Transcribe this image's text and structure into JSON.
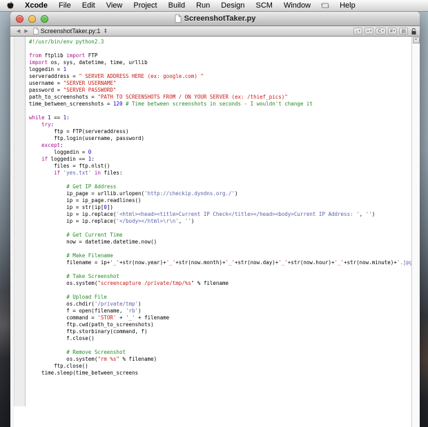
{
  "colors": {
    "traffic_red": "#ee6056",
    "traffic_yellow": "#f5bf4f",
    "traffic_green": "#61c554",
    "syntax_keyword": "#a90d91",
    "syntax_number": "#1c00cf",
    "syntax_string": "#c41a16",
    "syntax_charstring": "#5861a8",
    "syntax_comment": "#248a24"
  },
  "menu_bar": {
    "items": [
      "Xcode",
      "File",
      "Edit",
      "View",
      "Project",
      "Build",
      "Run",
      "Design",
      "SCM",
      "Window"
    ],
    "help_label": "Help",
    "apple_icon": "apple-logo",
    "script_icon": "script-menu-scroll"
  },
  "window": {
    "title": "ScreenshotTaker.py"
  },
  "nav_bar": {
    "back_label": "◀",
    "forward_label": "▶",
    "location": "ScreenshotTaker.py:1",
    "stepper_up": "▲",
    "stepper_down": "▼",
    "right_buttons": [
      {
        "name": "history-menu-button",
        "glyph": "↓",
        "has_arrow": true
      },
      {
        "name": "bookmarks-menu-button",
        "glyph": "≈",
        "has_arrow": true
      },
      {
        "name": "class-hierarchy-menu-button",
        "glyph": "C",
        "has_arrow": true
      },
      {
        "name": "marks-menu-button",
        "glyph": "#",
        "has_arrow": true
      },
      {
        "name": "counterpart-button",
        "glyph": "▤",
        "has_arrow": false
      }
    ],
    "split_button_glyph": "="
  },
  "editor": {
    "lines": [
      [
        [
          "c",
          "#!/usr/bin/env python2.3"
        ]
      ],
      [],
      [
        [
          "k",
          "from"
        ],
        [
          "p",
          " ftplib "
        ],
        [
          "k",
          "import"
        ],
        [
          "p",
          " FTP"
        ]
      ],
      [
        [
          "k",
          "import"
        ],
        [
          "p",
          " os, sys, datetime, time, urllib"
        ]
      ],
      [
        [
          "p",
          "loggedin = "
        ],
        [
          "n",
          "1"
        ]
      ],
      [
        [
          "p",
          "serveraddress = "
        ],
        [
          "s",
          "\" SERVER ADDRESS HERE (ex: google.com) \""
        ]
      ],
      [
        [
          "p",
          "username = "
        ],
        [
          "s",
          "\"SERVER USERNAME\""
        ]
      ],
      [
        [
          "p",
          "password = "
        ],
        [
          "s",
          "\"SERVER PASSWORD\""
        ]
      ],
      [
        [
          "p",
          "path_to_screenshots = "
        ],
        [
          "s",
          "\"PATH TO SCREENSHOTS FROM / ON YOUR SERVER (ex: /thief_pics)\""
        ]
      ],
      [
        [
          "p",
          "time_between_screenshots = "
        ],
        [
          "n",
          "120"
        ],
        [
          "c",
          " # Time between screenshots in seconds - I wouldn't change it"
        ]
      ],
      [],
      [
        [
          "k",
          "while"
        ],
        [
          "p",
          " "
        ],
        [
          "n",
          "1"
        ],
        [
          "p",
          " == "
        ],
        [
          "n",
          "1"
        ],
        [
          "p",
          ":"
        ]
      ],
      [
        [
          "p",
          "    "
        ],
        [
          "k",
          "try"
        ],
        [
          "p",
          ":"
        ]
      ],
      [
        [
          "p",
          "        ftp = FTP(serveraddress)"
        ]
      ],
      [
        [
          "p",
          "        ftp.login(username, password)"
        ]
      ],
      [
        [
          "p",
          "    "
        ],
        [
          "k",
          "except"
        ],
        [
          "p",
          ":"
        ]
      ],
      [
        [
          "p",
          "        loggedin = "
        ],
        [
          "n",
          "0"
        ]
      ],
      [
        [
          "p",
          "    "
        ],
        [
          "k",
          "if"
        ],
        [
          "p",
          " loggedin == "
        ],
        [
          "n",
          "1"
        ],
        [
          "p",
          ":"
        ]
      ],
      [
        [
          "p",
          "        files = ftp.nlst()"
        ]
      ],
      [
        [
          "p",
          "        "
        ],
        [
          "k",
          "if"
        ],
        [
          "p",
          " "
        ],
        [
          "q",
          "'yes.txt'"
        ],
        [
          "p",
          " "
        ],
        [
          "k",
          "in"
        ],
        [
          "p",
          " files:"
        ]
      ],
      [],
      [
        [
          "p",
          "            "
        ],
        [
          "c",
          "# Get IP Address"
        ]
      ],
      [
        [
          "p",
          "            ip_page = urllib.urlopen("
        ],
        [
          "q",
          "'http://checkip.dyndns.org./'"
        ],
        [
          "p",
          ")"
        ]
      ],
      [
        [
          "p",
          "            ip = ip_page.readlines()"
        ]
      ],
      [
        [
          "p",
          "            ip = str(ip["
        ],
        [
          "n",
          "0"
        ],
        [
          "p",
          "])"
        ]
      ],
      [
        [
          "p",
          "            ip = ip.replace("
        ],
        [
          "q",
          "'<html><head><title>Current IP Check</title></head><body>Current IP Address: '"
        ],
        [
          "p",
          ", "
        ],
        [
          "q",
          "''"
        ],
        [
          "p",
          ")"
        ]
      ],
      [
        [
          "p",
          "            ip = ip.replace("
        ],
        [
          "q",
          "'</body></html>\\r\\n'"
        ],
        [
          "p",
          ", "
        ],
        [
          "q",
          "''"
        ],
        [
          "p",
          ")"
        ]
      ],
      [],
      [
        [
          "p",
          "            "
        ],
        [
          "c",
          "# Get Current Time"
        ]
      ],
      [
        [
          "p",
          "            now = datetime.datetime.now()"
        ]
      ],
      [],
      [
        [
          "p",
          "            "
        ],
        [
          "c",
          "# Make Filename"
        ]
      ],
      [
        [
          "p",
          "            filename = ip+"
        ],
        [
          "s",
          "'_'"
        ],
        [
          "p",
          "+str(now.year)+"
        ],
        [
          "s",
          "'_'"
        ],
        [
          "p",
          "+str(now.month)+"
        ],
        [
          "s",
          "'_'"
        ],
        [
          "p",
          "+str(now.day)+"
        ],
        [
          "s",
          "'_'"
        ],
        [
          "p",
          "+str(now.hour)+"
        ],
        [
          "s",
          "'_'"
        ],
        [
          "p",
          "+str(now.minute)+"
        ],
        [
          "q",
          "'.jpg'"
        ]
      ],
      [],
      [
        [
          "p",
          "            "
        ],
        [
          "c",
          "# Take Screenshot"
        ]
      ],
      [
        [
          "p",
          "            os.system("
        ],
        [
          "s",
          "\"screencapture /private/tmp/%s\""
        ],
        [
          "p",
          " % filename"
        ]
      ],
      [],
      [
        [
          "p",
          "            "
        ],
        [
          "c",
          "# Upload File"
        ]
      ],
      [
        [
          "p",
          "            os.chdir("
        ],
        [
          "q",
          "'/private/tmp'"
        ],
        [
          "p",
          ")"
        ]
      ],
      [
        [
          "p",
          "            f = open(filename, "
        ],
        [
          "q",
          "'rb'"
        ],
        [
          "p",
          ")"
        ]
      ],
      [
        [
          "p",
          "            command = "
        ],
        [
          "s",
          "'STOR'"
        ],
        [
          "p",
          " + "
        ],
        [
          "s",
          "'_'"
        ],
        [
          "p",
          " + filename"
        ]
      ],
      [
        [
          "p",
          "            ftp.cwd(path_to_screenshots)"
        ]
      ],
      [
        [
          "p",
          "            ftp.storbinary(command, f)"
        ]
      ],
      [
        [
          "p",
          "            f.close()"
        ]
      ],
      [],
      [
        [
          "p",
          "            "
        ],
        [
          "c",
          "# Remove Screenshot"
        ]
      ],
      [
        [
          "p",
          "            os.system("
        ],
        [
          "s",
          "\"rm %s\""
        ],
        [
          "p",
          " % filename)"
        ]
      ],
      [
        [
          "p",
          "        ftp.close()"
        ]
      ],
      [
        [
          "p",
          "    time.sleep(time_between_screens"
        ]
      ]
    ]
  }
}
